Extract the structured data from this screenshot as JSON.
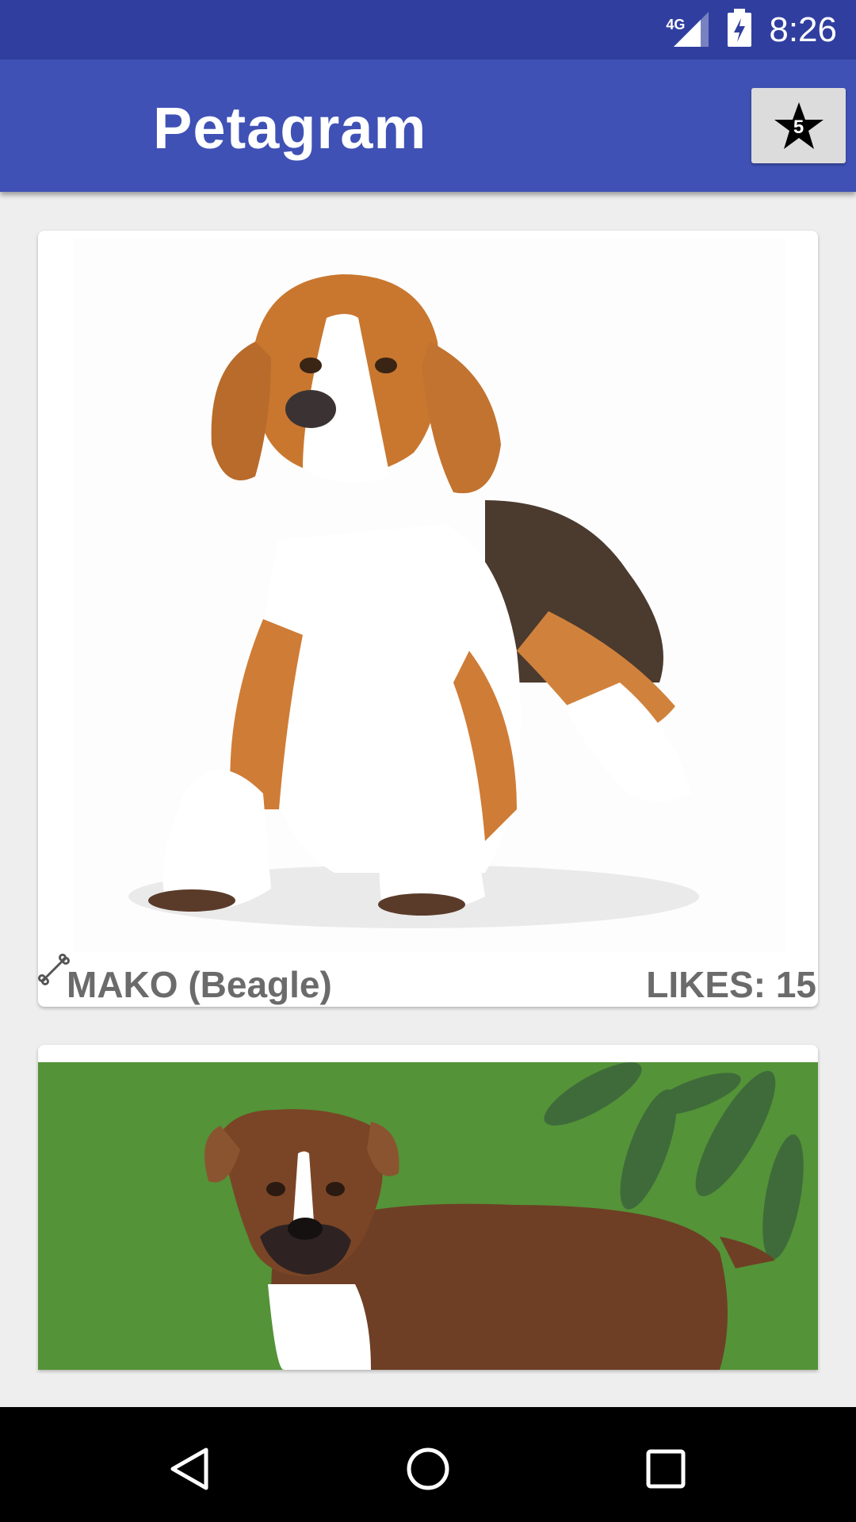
{
  "status_bar": {
    "network": "4G",
    "time": "8:26",
    "icons": [
      "signal-icon",
      "battery-charging-icon"
    ]
  },
  "app_bar": {
    "title": "Petagram",
    "favorites_count": "5",
    "favorites_icon": "star-icon",
    "background_color": "#3f51b5",
    "status_color": "#303f9f"
  },
  "pets": [
    {
      "name": "MAKO (Beagle)",
      "likes": "LIKES: 15",
      "icon": "bone-icon"
    }
  ],
  "nav_bar": {
    "icons": [
      "back-icon",
      "home-icon",
      "recents-icon"
    ]
  }
}
